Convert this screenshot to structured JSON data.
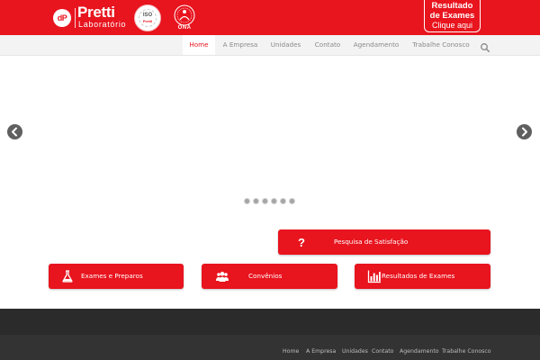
{
  "header": {
    "logo_mark": "dP",
    "brand_name": "Pretti",
    "brand_sub": "Laboratório",
    "seal_iso": {
      "text": "ISO",
      "sub": "Pretti"
    },
    "seal_ona": {
      "text": "ONA"
    },
    "results_cta": {
      "line1": "Resultado",
      "line2": "de Exames",
      "line3": "Clique aqui"
    },
    "brand_color": "#e8141e"
  },
  "nav": {
    "items": [
      {
        "label": "Home",
        "active": true
      },
      {
        "label": "A Empresa",
        "active": false
      },
      {
        "label": "Unidades",
        "active": false
      },
      {
        "label": "Contato",
        "active": false
      },
      {
        "label": "Agendamento",
        "active": false
      },
      {
        "label": "Trabalhe Conosco",
        "active": false
      }
    ],
    "search_icon": "search-icon"
  },
  "slider": {
    "prev_icon": "chevron-left-icon",
    "next_icon": "chevron-right-icon",
    "dot_count": 6
  },
  "quick_actions": {
    "survey": {
      "label": "Pesquisa de Satisfação",
      "icon": "question-icon"
    },
    "exams": {
      "label": "Exames e Preparos",
      "icon": "flask-icon"
    },
    "agreements": {
      "label": "Convênios",
      "icon": "users-icon"
    },
    "results": {
      "label": "Resultados de Exames",
      "icon": "bar-chart-icon"
    }
  },
  "footer": {
    "links": [
      "Home",
      "A Empresa",
      "Unidades",
      "Contato",
      "Agendamento",
      "Trabalhe Conosco"
    ]
  }
}
